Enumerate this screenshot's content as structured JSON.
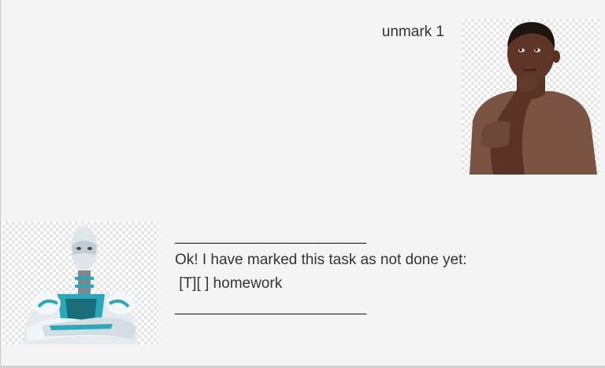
{
  "dialog": {
    "user_message": {
      "text": "unmark 1",
      "avatar_icon": "user-avatar"
    },
    "bot_message": {
      "lines": [
        "_______________________",
        "Ok! I have marked this task as not done yet:",
        " [T][ ] homework",
        "_______________________"
      ],
      "avatar_icon": "robot-avatar"
    }
  },
  "colors": {
    "background": "#f4f4f4",
    "text": "#333333"
  }
}
